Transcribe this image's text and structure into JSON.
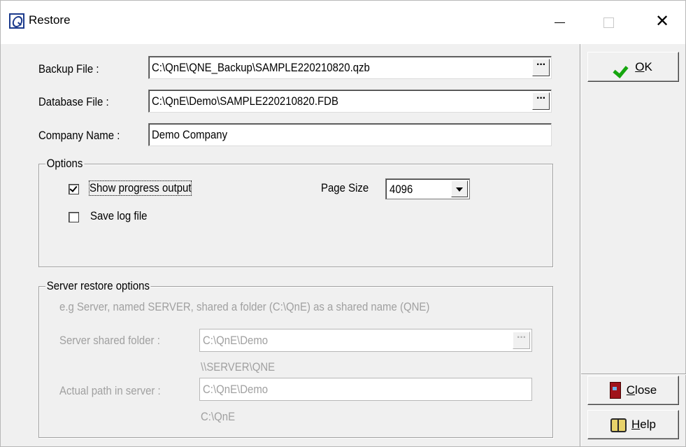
{
  "window": {
    "title": "Restore",
    "minimize": "—",
    "close": "✕"
  },
  "buttons": {
    "ok_label_underlined": "O",
    "ok_label_rest": "K",
    "close_label_underlined": "C",
    "close_label_rest": "lose",
    "help_label_underlined": "H",
    "help_label_rest": "elp"
  },
  "form": {
    "backup_file_label": "Backup File :",
    "backup_file_value": "C:\\QnE\\QNE_Backup\\SAMPLE220210820.qzb",
    "database_file_label": "Database File :",
    "database_file_value": "C:\\QnE\\Demo\\SAMPLE220210820.FDB",
    "company_name_label": "Company Name :",
    "company_name_value": "Demo Company",
    "browse_label": "···"
  },
  "options": {
    "title": "Options",
    "show_progress_label": "Show progress output",
    "show_progress_checked": true,
    "save_log_label": "Save log file",
    "save_log_checked": false,
    "page_size_label": "Page Size",
    "page_size_value": "4096"
  },
  "server_options": {
    "title": "Server restore options",
    "hint": "e.g Server, named SERVER, shared a folder (C:\\QnE) as a shared name (QNE)",
    "shared_folder_label": "Server shared folder :",
    "shared_folder_value": "C:\\QnE\\Demo",
    "shared_folder_preview": "\\\\SERVER\\QNE",
    "actual_path_label": "Actual path in server :",
    "actual_path_value": "C:\\QnE\\Demo",
    "actual_path_preview": "C:\\QnE"
  },
  "icons": {
    "app": "qne-app-icon",
    "ok": "green-check-icon",
    "close": "door-exit-icon",
    "help": "book-icon"
  }
}
